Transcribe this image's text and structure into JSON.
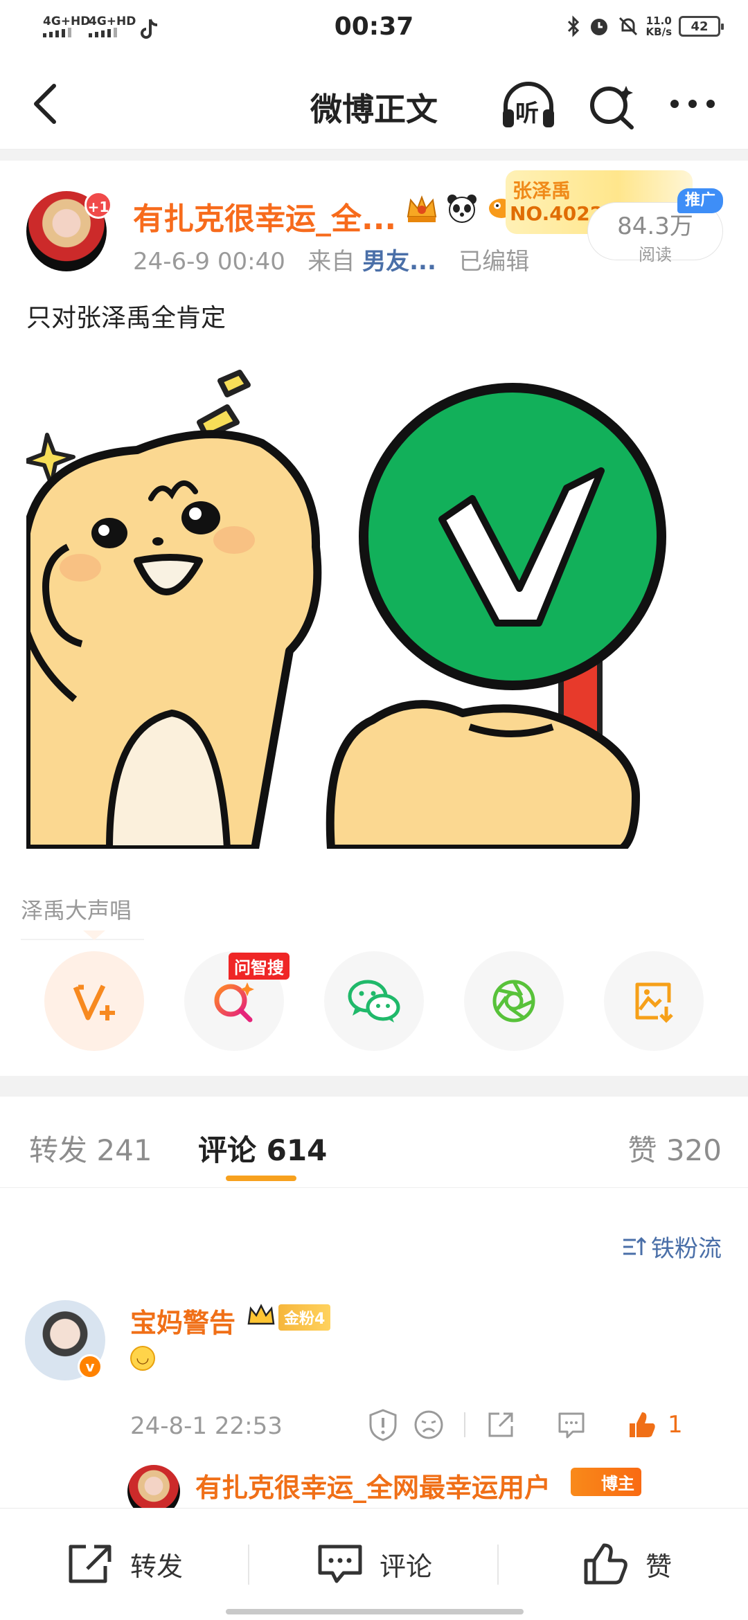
{
  "status_bar": {
    "network_1": "4G+HD",
    "network_2": "4G+HD",
    "time": "00:37",
    "speed_value": "11.0",
    "speed_unit": "KB/s",
    "battery": "42"
  },
  "nav": {
    "title": "微博正文",
    "listen_label": "听"
  },
  "post": {
    "username": "有扎克很幸运_全...",
    "fan_rank_name": "张泽禹",
    "fan_rank_no": "NO.4022",
    "reads_value": "84.3万",
    "reads_label": "阅读",
    "promo_badge": "推广",
    "time": "24-6-9 00:40",
    "source_prefix": "来自",
    "source": "男友...",
    "edited": "已编辑",
    "text": "只对张泽禹全肯定",
    "avatar_badge": "+1"
  },
  "topic": {
    "label": "泽禹大声唱"
  },
  "share": {
    "ai_search_badge": "问智搜"
  },
  "tabs": {
    "repost_label": "转发",
    "repost_count": "241",
    "comment_label": "评论",
    "comment_count": "614",
    "like_label": "赞",
    "like_count": "320"
  },
  "sort": {
    "label": "铁粉流"
  },
  "comment": {
    "username": "宝妈警告",
    "fan_badge": "金粉4",
    "time": "24-8-1 22:53",
    "like_count": "1"
  },
  "reply": {
    "username": "有扎克很幸运_全网最幸运用户",
    "badge": "博主"
  },
  "bottom_bar": {
    "repost": "转发",
    "comment": "评论",
    "like": "赞"
  },
  "colors": {
    "accent_orange": "#f76b1c",
    "link_blue": "#4a6fa8",
    "tab_underline": "#f7a11e",
    "ai_badge_red": "#ef2626",
    "check_green": "#12b05a"
  }
}
